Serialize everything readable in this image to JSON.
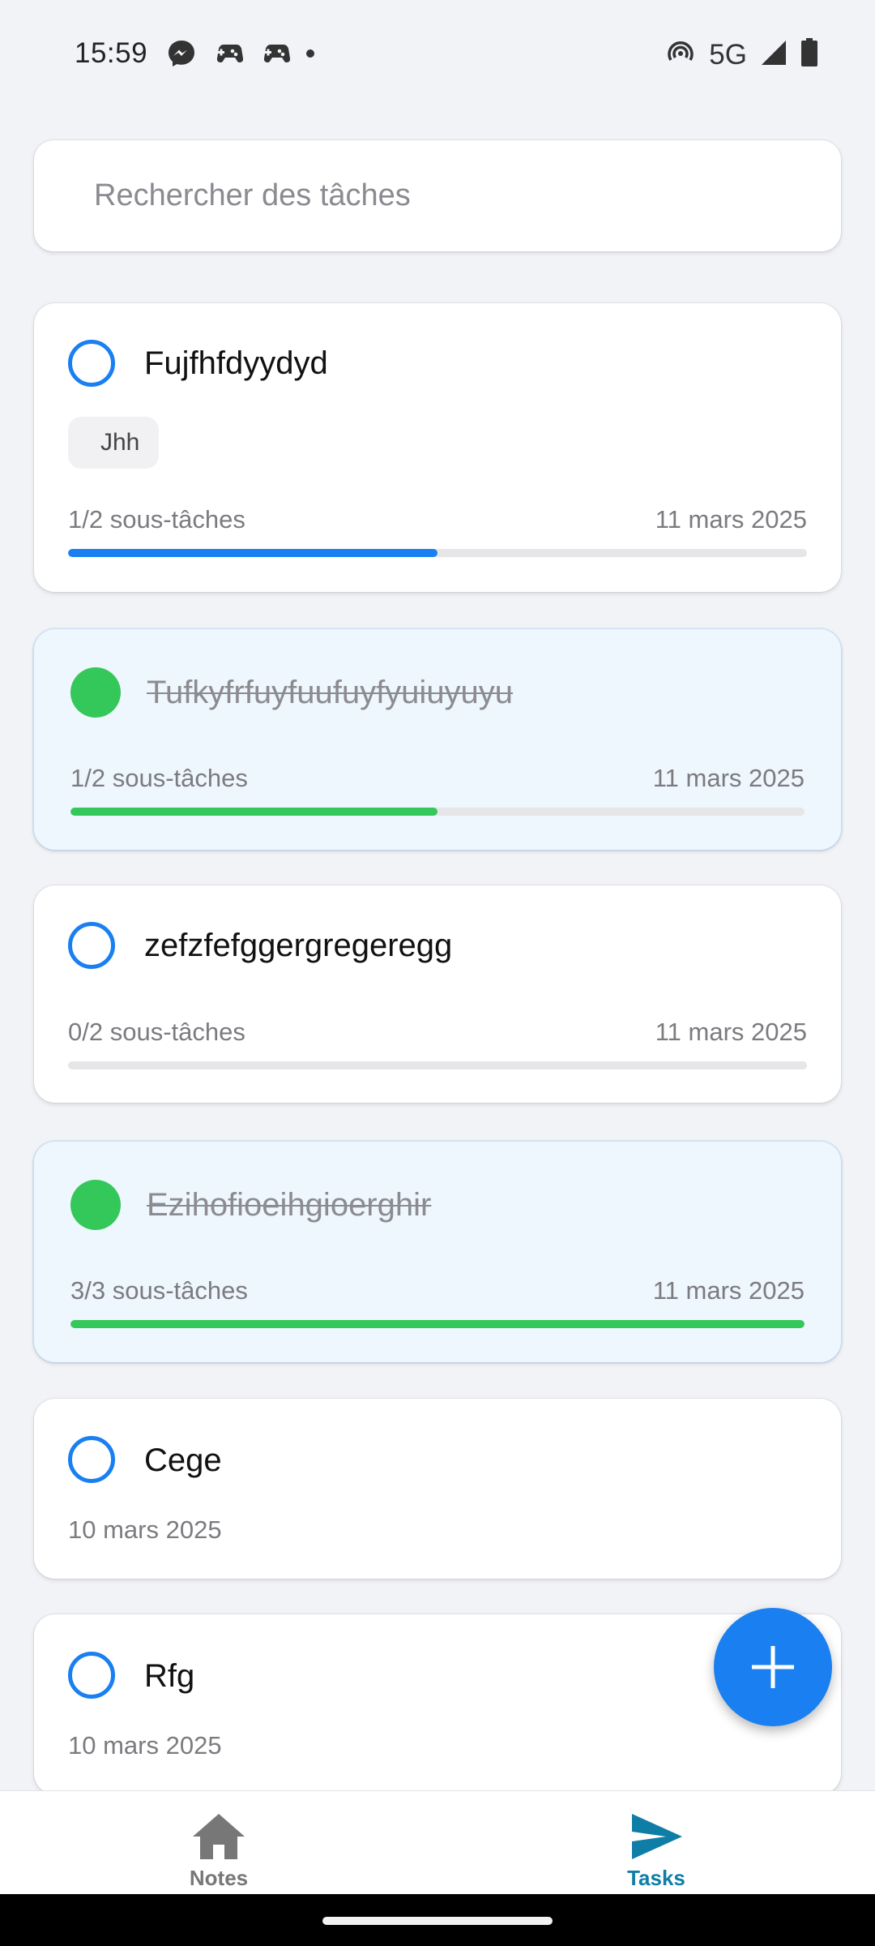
{
  "status_bar": {
    "time": "15:59",
    "network": "5G",
    "left_icons": [
      "messenger-icon",
      "game-controller-icon",
      "game-controller-icon",
      "dot-icon"
    ],
    "right_icons": [
      "hotspot-icon",
      "signal-icon",
      "battery-icon"
    ]
  },
  "search": {
    "placeholder": "Rechercher des tâches",
    "value": ""
  },
  "colors": {
    "accent": "#1a7ff0",
    "done": "#34c759",
    "done_card_bg": "#eef6fe",
    "nav_active": "#0f7ea6"
  },
  "tasks": [
    {
      "title": "Fujfhfdyydyd",
      "completed": false,
      "tag": "Jhh",
      "subtasks": "1/2 sous-tâches",
      "progress": 0.5,
      "date": "11 mars 2025"
    },
    {
      "title": "Tufkyfrfuyfuufuyfyuiuyuyu",
      "completed": true,
      "subtasks": "1/2 sous-tâches",
      "progress": 0.5,
      "date": "11 mars 2025"
    },
    {
      "title": "zefzfefggergregeregg",
      "completed": false,
      "subtasks": "0/2 sous-tâches",
      "progress": 0,
      "date": "11 mars 2025"
    },
    {
      "title": "Ezihofioeihgioerghir",
      "completed": true,
      "subtasks": "3/3 sous-tâches",
      "progress": 1,
      "date": "11 mars 2025"
    },
    {
      "title": "Cege",
      "completed": false,
      "date": "10 mars 2025"
    },
    {
      "title": "Rfg",
      "completed": false,
      "date": "10 mars 2025"
    }
  ],
  "fab": {
    "icon": "plus-icon"
  },
  "bottom_nav": {
    "items": [
      {
        "label": "Notes",
        "icon": "home-icon",
        "active": false
      },
      {
        "label": "Tasks",
        "icon": "send-icon",
        "active": true
      }
    ]
  }
}
